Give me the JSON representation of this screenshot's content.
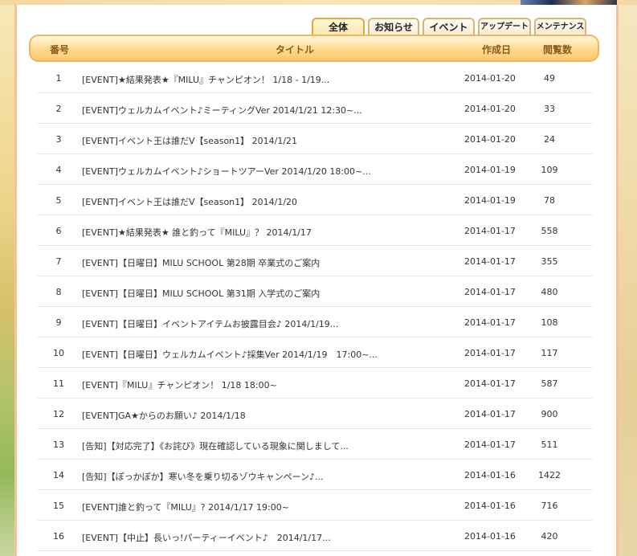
{
  "tabs": [
    {
      "label": "全体",
      "active": true
    },
    {
      "label": "お知らせ",
      "active": false
    },
    {
      "label": "イベント",
      "active": false
    },
    {
      "label": "アップデート",
      "active": false
    },
    {
      "label": "メンテナンス",
      "active": false
    }
  ],
  "header": {
    "no": "番号",
    "title": "タイトル",
    "date": "作成日",
    "views": "閲覧数"
  },
  "rows": [
    {
      "no": "1",
      "title": "[EVENT]★結果発表★『MILU』チャンピオン！ 1/18 - 1/19...",
      "date": "2014-01-20",
      "views": "49"
    },
    {
      "no": "2",
      "title": "[EVENT]ウェルカムイベント♪ミーティングVer 2014/1/21 12:30~...",
      "date": "2014-01-20",
      "views": "33"
    },
    {
      "no": "3",
      "title": "[EVENT]イベント王は誰だV【season1】 2014/1/21",
      "date": "2014-01-20",
      "views": "24"
    },
    {
      "no": "4",
      "title": "[EVENT]ウェルカムイベント♪ショートツアーVer 2014/1/20 18:00~...",
      "date": "2014-01-19",
      "views": "109"
    },
    {
      "no": "5",
      "title": "[EVENT]イベント王は誰だV【season1】 2014/1/20",
      "date": "2014-01-19",
      "views": "78"
    },
    {
      "no": "6",
      "title": "[EVENT]★結果発表★ 誰と釣って『MILU』？ 2014/1/17",
      "date": "2014-01-17",
      "views": "558"
    },
    {
      "no": "7",
      "title": "[EVENT]【日曜日】MILU SCHOOL 第28期 卒業式のご案内",
      "date": "2014-01-17",
      "views": "355"
    },
    {
      "no": "8",
      "title": "[EVENT]【日曜日】MILU SCHOOL 第31期 入学式のご案内",
      "date": "2014-01-17",
      "views": "480"
    },
    {
      "no": "9",
      "title": "[EVENT]【日曜日】イベントアイテムお披露目会♪ 2014/1/19...",
      "date": "2014-01-17",
      "views": "108"
    },
    {
      "no": "10",
      "title": "[EVENT]【日曜日】ウェルカムイベント♪採集Ver 2014/1/19　17:00~...",
      "date": "2014-01-17",
      "views": "117"
    },
    {
      "no": "11",
      "title": "[EVENT]『MILU』チャンピオン！ 1/18 18:00~",
      "date": "2014-01-17",
      "views": "587"
    },
    {
      "no": "12",
      "title": "[EVENT]GA★からのお願い♪ 2014/1/18",
      "date": "2014-01-17",
      "views": "900"
    },
    {
      "no": "13",
      "title": "[告知]【対応完了】《お詫び》現在確認している現象に関しまして...",
      "date": "2014-01-17",
      "views": "511"
    },
    {
      "no": "14",
      "title": "[告知]【ぽっかぽか】寒い冬を乗り切るゾウキャンペーン♪...",
      "date": "2014-01-16",
      "views": "1422"
    },
    {
      "no": "15",
      "title": "[EVENT]誰と釣って『MILU』? 2014/1/17 19:00~",
      "date": "2014-01-16",
      "views": "716"
    },
    {
      "no": "16",
      "title": "[EVENT]【中止】長いっ!パーティーイベント♪　2014/1/17...",
      "date": "2014-01-16",
      "views": "420"
    }
  ]
}
